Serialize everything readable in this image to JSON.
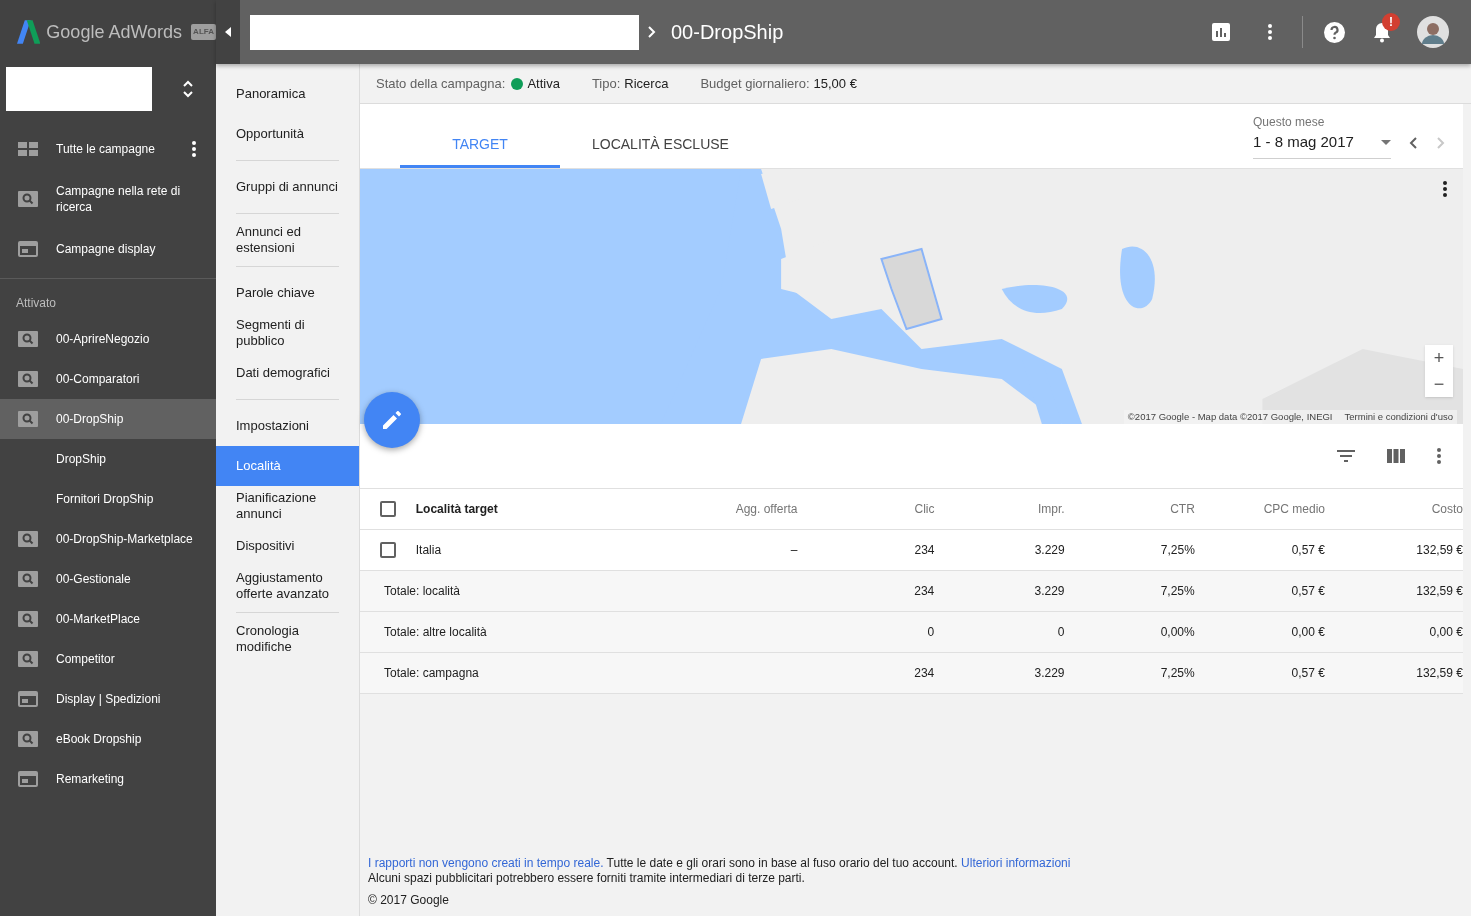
{
  "brand": {
    "name": "Google AdWords",
    "badge": "ALFA"
  },
  "header": {
    "breadcrumb_title": "00-DropShip",
    "notification_badge": "!"
  },
  "sidebar": {
    "top_items": [
      {
        "kind": "all",
        "label": "Tutte le campagne"
      },
      {
        "kind": "search",
        "label": "Campagne nella rete di ricerca"
      },
      {
        "kind": "display",
        "label": "Campagne display"
      }
    ],
    "section_label": "Attivato",
    "campaigns": [
      {
        "kind": "search",
        "label": "00-AprireNegozio",
        "selected": false
      },
      {
        "kind": "search",
        "label": "00-Comparatori",
        "selected": false
      },
      {
        "kind": "search",
        "label": "00-DropShip",
        "selected": true
      },
      {
        "kind": "sub",
        "label": "DropShip",
        "selected": false
      },
      {
        "kind": "sub",
        "label": "Fornitori DropShip",
        "selected": false
      },
      {
        "kind": "search",
        "label": "00-DropShip-Marketplace",
        "selected": false
      },
      {
        "kind": "search",
        "label": "00-Gestionale",
        "selected": false
      },
      {
        "kind": "search",
        "label": "00-MarketPlace",
        "selected": false
      },
      {
        "kind": "search",
        "label": "Competitor",
        "selected": false
      },
      {
        "kind": "display",
        "label": "Display | Spedizioni",
        "selected": false
      },
      {
        "kind": "search",
        "label": "eBook Dropship",
        "selected": false
      },
      {
        "kind": "display",
        "label": "Remarketing",
        "selected": false
      }
    ]
  },
  "subnav": {
    "groups": [
      [
        {
          "label": "Panoramica",
          "selected": false
        },
        {
          "label": "Opportunità",
          "selected": false
        }
      ],
      [
        {
          "label": "Gruppi di annunci",
          "selected": false
        }
      ],
      [
        {
          "label": "Annunci ed estensioni",
          "selected": false
        }
      ],
      [
        {
          "label": "Parole chiave",
          "selected": false
        },
        {
          "label": "Segmenti di pubblico",
          "selected": false
        },
        {
          "label": "Dati demografici",
          "selected": false
        }
      ],
      [
        {
          "label": "Impostazioni",
          "selected": false
        },
        {
          "label": "Località",
          "selected": true
        },
        {
          "label": "Pianificazione annunci",
          "selected": false
        },
        {
          "label": "Dispositivi",
          "selected": false
        },
        {
          "label": "Aggiustamento offerte avanzato",
          "selected": false
        }
      ],
      [
        {
          "label": "Cronologia modifiche",
          "selected": false
        }
      ]
    ]
  },
  "status_bar": [
    {
      "label": "Stato della campagna:",
      "value": "Attiva",
      "color": "#0f9d58"
    },
    {
      "label": "Tipo:",
      "value": "Ricerca"
    },
    {
      "label": "Budget giornaliero:",
      "value": "15,00 €"
    }
  ],
  "tabs": [
    {
      "label": "TARGET",
      "selected": true
    },
    {
      "label": "LOCALITÀ ESCLUSE",
      "selected": false
    }
  ],
  "date_range": {
    "label": "Questo mese",
    "value": "1 - 8 mag 2017",
    "next_disabled": true
  },
  "map": {
    "kind": "picture",
    "attribution": "©2017 Google - Map data ©2017 Google, INEGI",
    "terms": "Termini e condizioni d'uso",
    "zoom_in": "+",
    "zoom_out": "−"
  },
  "table": {
    "all_checked": false,
    "columns": [
      "Località target",
      "Agg. offerta",
      "Clic",
      "Impr.",
      "CTR",
      "CPC medio",
      "Costo"
    ],
    "rows": [
      {
        "kind": "item",
        "checked": false,
        "cells": [
          "Italia",
          "–",
          "234",
          "3.229",
          "7,25%",
          "0,57 €",
          "132,59 €"
        ]
      },
      {
        "kind": "total",
        "cells": [
          "Totale: località",
          "",
          "234",
          "3.229",
          "7,25%",
          "0,57 €",
          "132,59 €"
        ]
      },
      {
        "kind": "total",
        "cells": [
          "Totale: altre località",
          "",
          "0",
          "0",
          "0,00%",
          "0,00 €",
          "0,00 €"
        ]
      },
      {
        "kind": "total",
        "cells": [
          "Totale: campagna",
          "",
          "234",
          "3.229",
          "7,25%",
          "0,57 €",
          "132,59 €"
        ]
      }
    ]
  },
  "footer": {
    "line_1": [
      {
        "kind": "link",
        "text": "I rapporti non vengono creati in tempo reale."
      },
      {
        "kind": "text",
        "text": "Tutte le date e gli orari sono in base al fuso orario del tuo account."
      },
      {
        "kind": "link",
        "text": "Ulteriori informazioni"
      }
    ],
    "line_2": "Alcuni spazi pubblicitari potrebbero essere forniti tramite intermediari di terze parti.",
    "copyright": "© 2017 Google"
  }
}
